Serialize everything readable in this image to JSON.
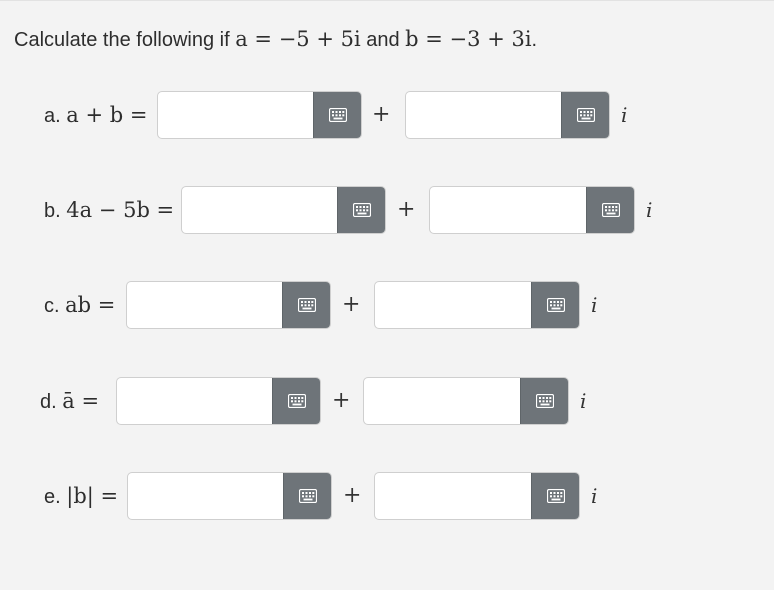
{
  "question": {
    "prefix": "Calculate the following if ",
    "a_expr": "a = −5 + 5i",
    "conj": " and ",
    "b_expr": "b = −3 + 3i",
    "suffix": "."
  },
  "parts": [
    {
      "letter": "a.",
      "expr": "a + b =",
      "real_value": "",
      "imag_value": "",
      "plus": "+",
      "imag_unit": "i"
    },
    {
      "letter": "b.",
      "expr": "4a − 5b =",
      "real_value": "",
      "imag_value": "",
      "plus": "+",
      "imag_unit": "i"
    },
    {
      "letter": "c.",
      "expr": "ab =",
      "real_value": "",
      "imag_value": "",
      "plus": "+",
      "imag_unit": "i"
    },
    {
      "letter": "d.",
      "expr": "ā =",
      "real_value": "",
      "imag_value": "",
      "plus": "+",
      "imag_unit": "i"
    },
    {
      "letter": "e.",
      "expr": "|b| =",
      "real_value": "",
      "imag_value": "",
      "plus": "+",
      "imag_unit": "i"
    }
  ],
  "icons": {
    "keyboard": "keyboard-icon"
  },
  "colors": {
    "background": "#f3f3f3",
    "keyboard_button": "#6e7479",
    "input_border": "#cfcfcf"
  }
}
